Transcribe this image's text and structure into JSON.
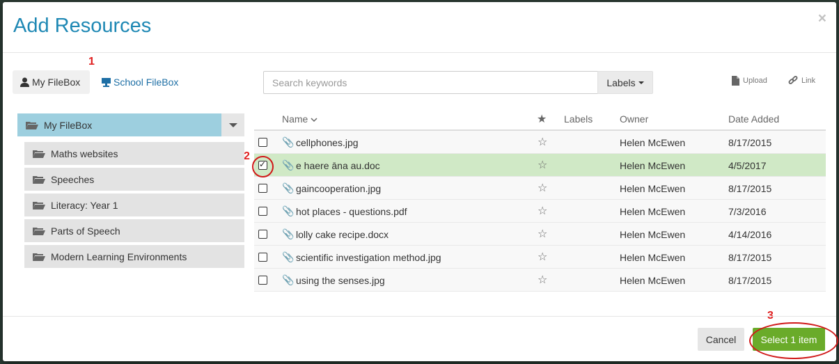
{
  "dialog": {
    "title": "Add Resources",
    "close_glyph": "×"
  },
  "annotations": [
    "1",
    "2",
    "3"
  ],
  "tabs": [
    {
      "label": "My FileBox",
      "icon": "user-icon",
      "active": true
    },
    {
      "label": "School FileBox",
      "icon": "school-icon",
      "active": false
    }
  ],
  "search": {
    "placeholder": "Search keywords",
    "value": ""
  },
  "labels_button": "Labels",
  "toolbar": {
    "upload_label": "Upload",
    "link_label": "Link"
  },
  "folders": {
    "root": "My FileBox",
    "items": [
      "Maths websites",
      "Speeches",
      "Literacy: Year 1",
      "Parts of Speech",
      "Modern Learning Environments"
    ]
  },
  "table": {
    "columns": {
      "name": "Name",
      "star": "★",
      "labels": "Labels",
      "owner": "Owner",
      "date": "Date Added"
    },
    "rows": [
      {
        "name": "cellphones.jpg",
        "owner": "Helen McEwen",
        "date": "8/17/2015",
        "checked": false
      },
      {
        "name": "e haere āna au.doc",
        "owner": "Helen McEwen",
        "date": "4/5/2017",
        "checked": true
      },
      {
        "name": "gaincooperation.jpg",
        "owner": "Helen McEwen",
        "date": "8/17/2015",
        "checked": false
      },
      {
        "name": "hot places - questions.pdf",
        "owner": "Helen McEwen",
        "date": "7/3/2016",
        "checked": false
      },
      {
        "name": "lolly cake recipe.docx",
        "owner": "Helen McEwen",
        "date": "4/14/2016",
        "checked": false
      },
      {
        "name": "scientific investigation method.jpg",
        "owner": "Helen McEwen",
        "date": "8/17/2015",
        "checked": false
      },
      {
        "name": "using the senses.jpg",
        "owner": "Helen McEwen",
        "date": "8/17/2015",
        "checked": false
      }
    ]
  },
  "footer": {
    "cancel_label": "Cancel",
    "select_label": "Select 1 item"
  },
  "colors": {
    "accent": "#1e88b4",
    "selected_row": "#d0e9c6",
    "primary_button": "#6aab2a",
    "annotation": "#d01818"
  }
}
